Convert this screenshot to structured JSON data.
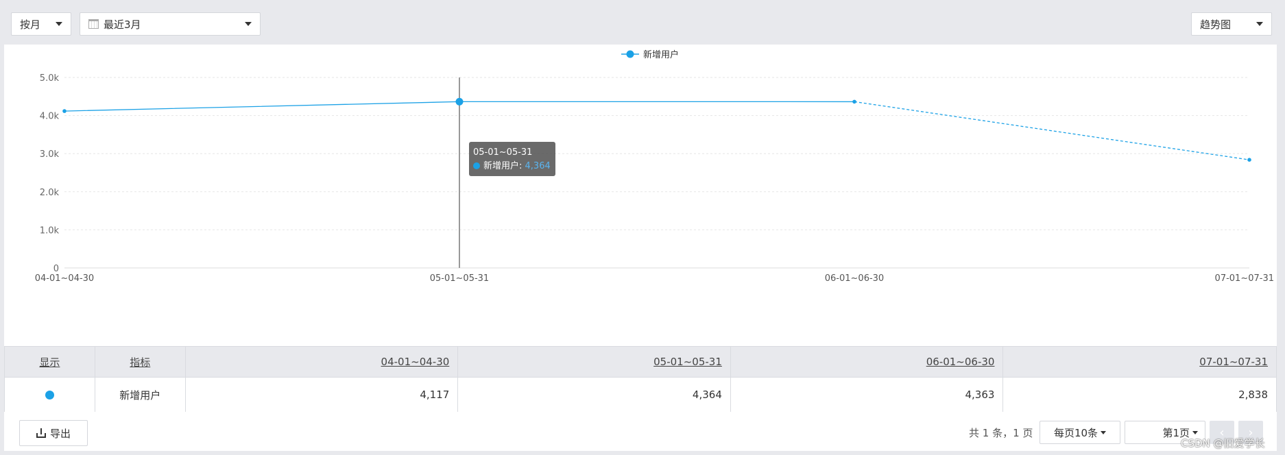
{
  "toolbar": {
    "period_select": "按月",
    "range_select": "最近3月",
    "view_select": "趋势图"
  },
  "chart_data": {
    "type": "line",
    "categories": [
      "04-01~04-30",
      "05-01~05-31",
      "06-01~06-30",
      "07-01~07-31"
    ],
    "series": [
      {
        "name": "新增用户",
        "values": [
          4117,
          4364,
          4363,
          2838
        ],
        "color": "#1ba1e6",
        "dashed_last_segment": true
      }
    ],
    "ylim": [
      0,
      5000
    ],
    "yticks": [
      "0",
      "1.0k",
      "2.0k",
      "3.0k",
      "4.0k",
      "5.0k"
    ],
    "legend": "top-center",
    "grid": true,
    "tooltip": {
      "title": "05-01~05-31",
      "series": "新增用户",
      "value": "4,364",
      "index": 1
    }
  },
  "table": {
    "headers": [
      "显示",
      "指标",
      "04-01~04-30",
      "05-01~05-31",
      "06-01~06-30",
      "07-01~07-31"
    ],
    "row": {
      "metric": "新增用户",
      "values": [
        "4,117",
        "4,364",
        "4,363",
        "2,838"
      ]
    }
  },
  "footer": {
    "export_label": "导出",
    "page_info": "共 1 条，1 页",
    "page_size": "每页10条",
    "page_num": "第1页",
    "prev": "‹",
    "next": "›"
  },
  "watermark": "CSDN @旧爱学长"
}
